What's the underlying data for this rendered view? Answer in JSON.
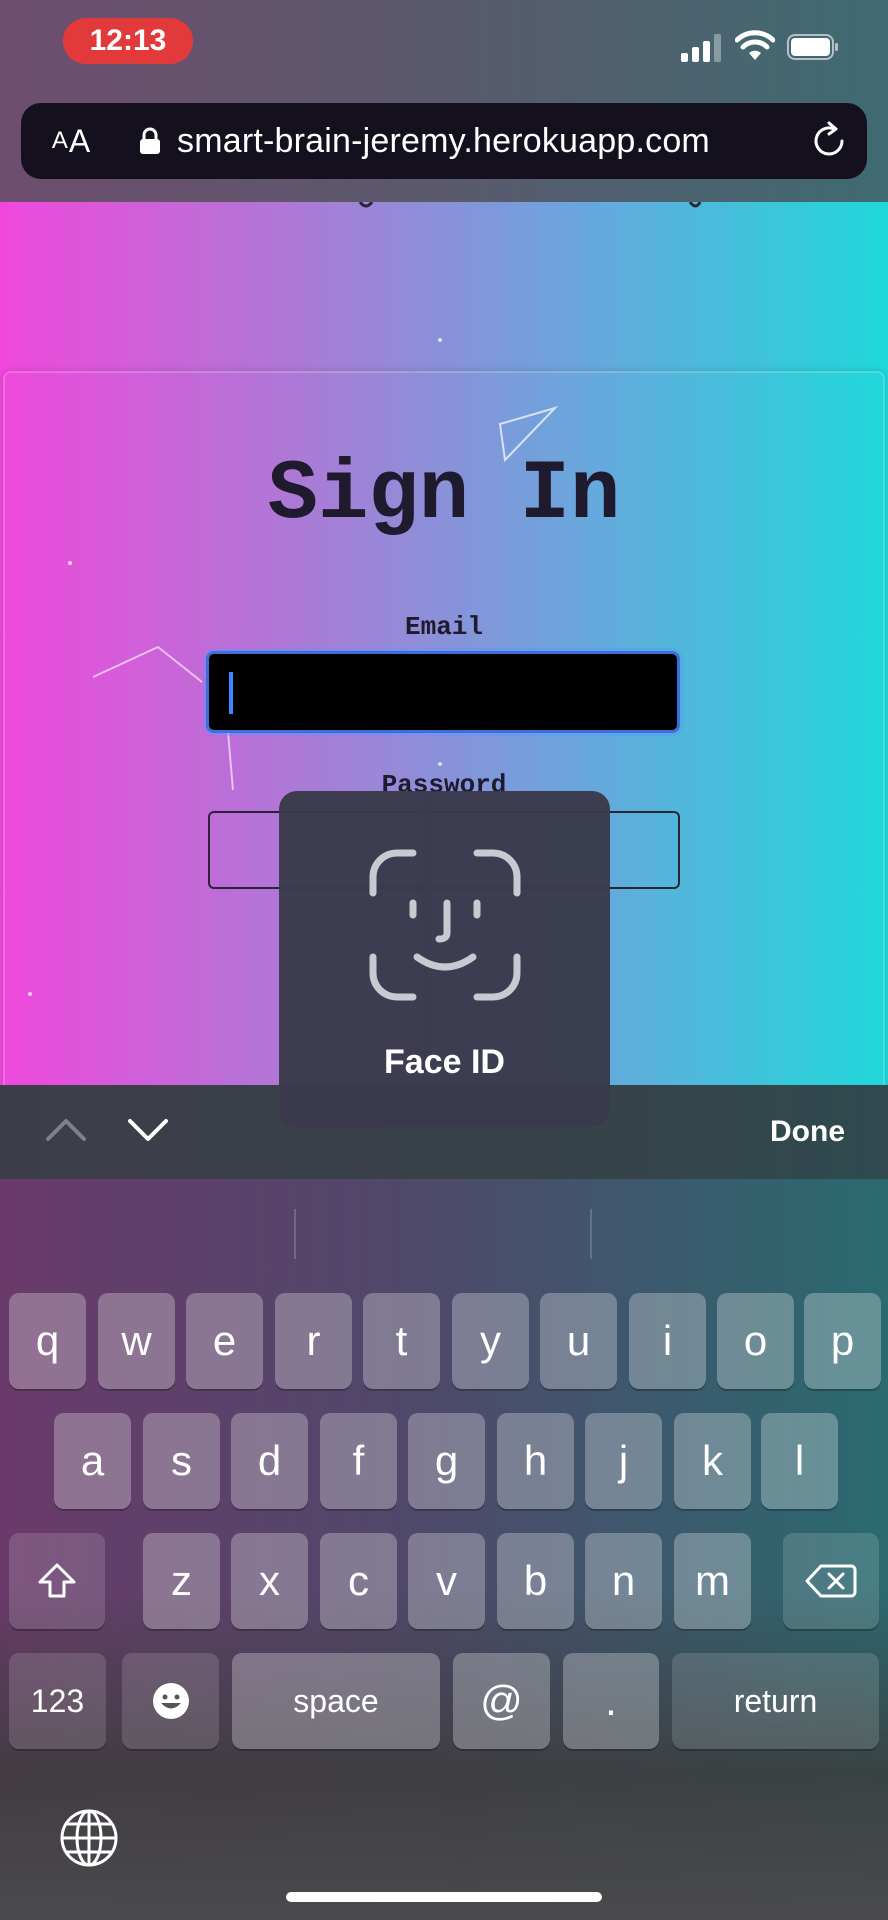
{
  "status_bar": {
    "time": "12:13"
  },
  "browser": {
    "text_size_label_small": "A",
    "text_size_label_large": "A",
    "url": "smart-brain-jeremy.herokuapp.com"
  },
  "signin": {
    "title": "Sign In",
    "email_label": "Email",
    "email_value": "",
    "password_label": "Password"
  },
  "faceid": {
    "label": "Face ID"
  },
  "accessory": {
    "done_label": "Done"
  },
  "keyboard": {
    "row1": [
      "q",
      "w",
      "e",
      "r",
      "t",
      "y",
      "u",
      "i",
      "o",
      "p"
    ],
    "row2": [
      "a",
      "s",
      "d",
      "f",
      "g",
      "h",
      "j",
      "k",
      "l"
    ],
    "row3": [
      "z",
      "x",
      "c",
      "v",
      "b",
      "n",
      "m"
    ],
    "numbers_label": "123",
    "space_label": "space",
    "at_label": "@",
    "dot_label": ".",
    "return_label": "return"
  },
  "colors": {
    "time_pill": "#e23a3a",
    "focus_ring": "#3b6fd9",
    "gradient_left": "#f048dc",
    "gradient_right": "#1fd8da"
  }
}
